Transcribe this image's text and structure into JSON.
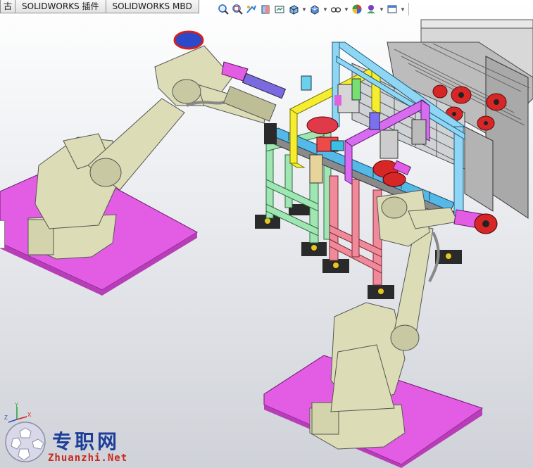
{
  "tabs": [
    {
      "label": "古"
    },
    {
      "label": "SOLIDWORKS 插件"
    },
    {
      "label": "SOLIDWORKS MBD"
    }
  ],
  "heads_up_toolbar": {
    "icons": [
      "zoom-to-fit-icon",
      "zoom-to-area-icon",
      "previous-view-icon",
      "section-view-icon",
      "dynamic-annotation-icon",
      "view-orientation-icon",
      "display-style-icon",
      "hide-show-items-icon",
      "edit-appearance-icon",
      "apply-scene-icon",
      "view-settings-icon"
    ]
  },
  "triad": {
    "x_label": "X",
    "y_label": "Y",
    "z_label": "Z"
  },
  "watermark": {
    "chinese": "专职网",
    "english": "Zhuanzhi.Net"
  },
  "colors": {
    "platform": "#e25de3",
    "robot": "#dcdcb6",
    "frame_green": "#9fe6b3",
    "frame_pink": "#f08a9a",
    "beam_yellow": "#f5ee30",
    "beam_blue": "#8fd6f5",
    "beam_magenta": "#d86cf0",
    "belt_purple": "#7a6ae0",
    "brand_blue": "#1d3f99",
    "brand_red": "#c8281e"
  }
}
